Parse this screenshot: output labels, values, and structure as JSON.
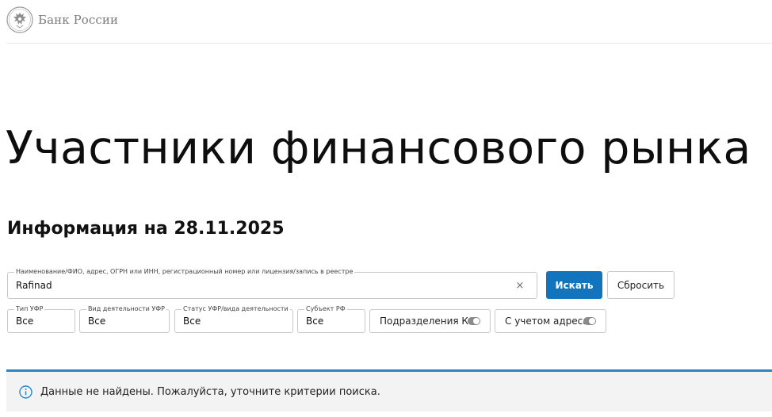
{
  "header": {
    "logo_text": "Банк России"
  },
  "page": {
    "title": "Участники финансового рынка",
    "info_date": "Информация на 28.11.2025"
  },
  "search": {
    "label": "Наименование/ФИО, адрес, ОГРН или ИНН, регистрационный номер или лицензия/запись в реестре",
    "value": "Rafinad",
    "clear_glyph": "×",
    "submit_label": "Искать",
    "reset_label": "Сбросить"
  },
  "filters": [
    {
      "label": "Тип УФР",
      "value": "Все"
    },
    {
      "label": "Вид деятельности УФР",
      "value": "Все"
    },
    {
      "label": "Статус УФР/вида деятельности",
      "value": "Все"
    },
    {
      "label": "Субъект РФ",
      "value": "Все"
    }
  ],
  "toggles": [
    {
      "label": "Подразделения КО",
      "on": false
    },
    {
      "label": "С учетом адреса",
      "on": false
    }
  ],
  "notice": {
    "icon": "info-icon",
    "text": "Данные не найдены. Пожалуйста, уточните критерии поиска."
  },
  "colors": {
    "accent": "#1274bd",
    "results_bar": "#2a86c9",
    "notice_bg": "#f3f3f3",
    "logo_gray": "#7d7d7d"
  }
}
